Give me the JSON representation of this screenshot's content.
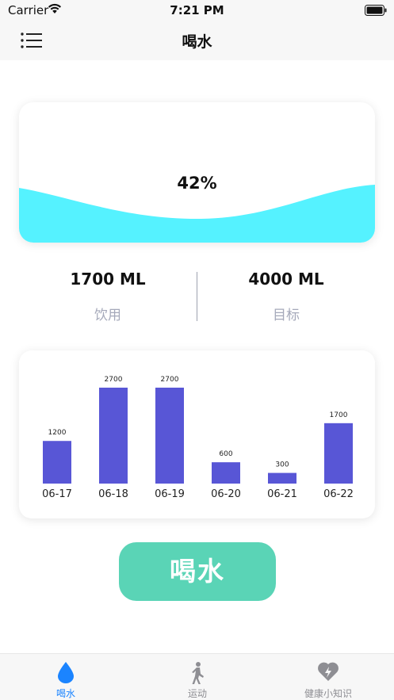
{
  "status_bar": {
    "carrier": "Carrier",
    "time": "7:21 PM"
  },
  "nav": {
    "title": "喝水"
  },
  "progress": {
    "percent_label": "42%",
    "fill_fraction": 0.42,
    "wave_color": "#55f2ff"
  },
  "stats": {
    "drunk": {
      "value": "1700 ML",
      "label": "饮用"
    },
    "goal": {
      "value": "4000 ML",
      "label": "目标"
    }
  },
  "chart_data": {
    "type": "bar",
    "categories": [
      "06-17",
      "06-18",
      "06-19",
      "06-20",
      "06-21",
      "06-22"
    ],
    "values": [
      1200,
      2700,
      2700,
      600,
      300,
      1700
    ],
    "value_labels": [
      "1200",
      "2700",
      "2700",
      "600",
      "300",
      "1700"
    ],
    "color": "#5856d6",
    "ylim": [
      0,
      2700
    ],
    "grid": false,
    "legend": "none",
    "title": "",
    "xlabel": "",
    "ylabel": ""
  },
  "drink_button": {
    "label": "喝水",
    "color": "#5ad4b6"
  },
  "tabs": [
    {
      "label": "喝水",
      "icon": "water-drop-icon",
      "active": true
    },
    {
      "label": "运动",
      "icon": "walking-person-icon",
      "active": false
    },
    {
      "label": "健康小知识",
      "icon": "heart-bolt-icon",
      "active": false
    }
  ],
  "colors": {
    "accent": "#1b84ff",
    "bar": "#5856d6",
    "button": "#5ad4b6",
    "muted_text": "#a5a9ba"
  }
}
